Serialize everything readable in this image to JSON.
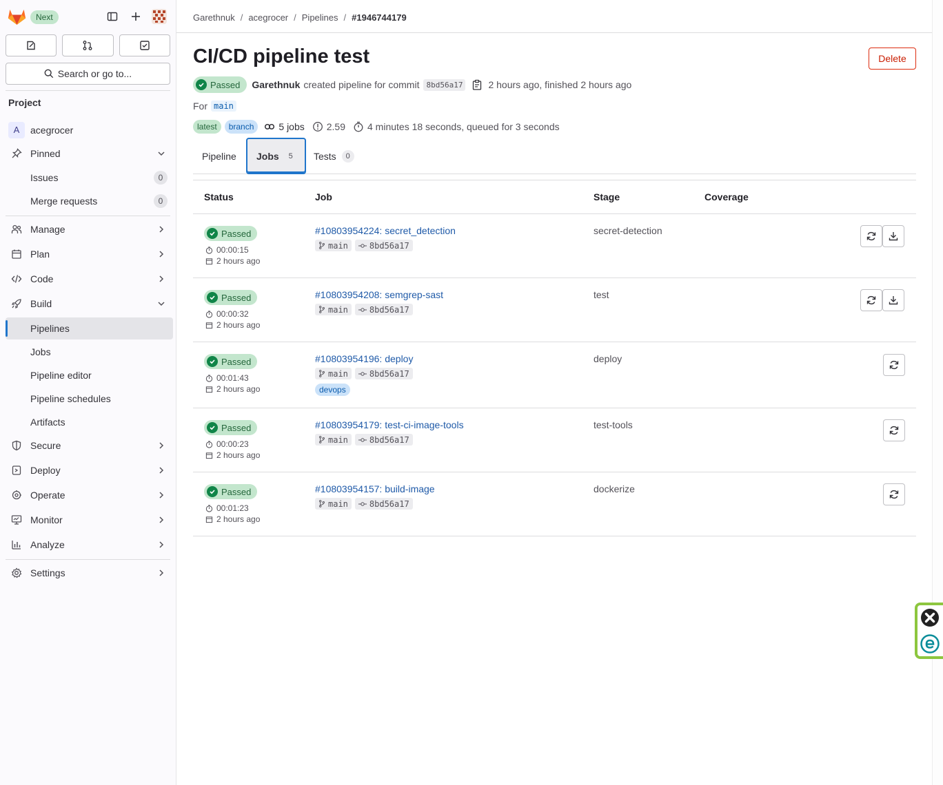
{
  "sidebar": {
    "next_badge": "Next",
    "search_label": "Search or go to...",
    "section_title": "Project",
    "project_avatar_letter": "A",
    "project_name": "acegrocer",
    "items": {
      "pinned": "Pinned",
      "issues": "Issues",
      "issues_count": "0",
      "merge_requests": "Merge requests",
      "merge_requests_count": "0",
      "manage": "Manage",
      "plan": "Plan",
      "code": "Code",
      "build": "Build",
      "pipelines": "Pipelines",
      "jobs": "Jobs",
      "pipeline_editor": "Pipeline editor",
      "pipeline_schedules": "Pipeline schedules",
      "artifacts": "Artifacts",
      "secure": "Secure",
      "deploy": "Deploy",
      "operate": "Operate",
      "monitor": "Monitor",
      "analyze": "Analyze",
      "settings": "Settings"
    }
  },
  "breadcrumb": {
    "items": [
      "Garethnuk",
      "acegrocer",
      "Pipelines"
    ],
    "current": "#1946744179"
  },
  "header": {
    "title": "CI/CD pipeline test",
    "delete_label": "Delete",
    "status": "Passed",
    "author": "Garethnuk",
    "created_text": "created pipeline for commit",
    "commit": "8bd56a17",
    "timing": "2 hours ago, finished 2 hours ago",
    "for_label": "For",
    "branch": "main",
    "tag_latest": "latest",
    "tag_branch": "branch",
    "jobs_count": "5 jobs",
    "compute": "2.59",
    "duration": "4 minutes 18 seconds, queued for 3 seconds"
  },
  "tabs": {
    "pipeline": "Pipeline",
    "jobs": "Jobs",
    "jobs_count": "5",
    "tests": "Tests",
    "tests_count": "0"
  },
  "table": {
    "headers": {
      "status": "Status",
      "job": "Job",
      "stage": "Stage",
      "coverage": "Coverage"
    },
    "rows": [
      {
        "status": "Passed",
        "duration": "00:00:15",
        "when": "2 hours ago",
        "job": "#10803954224: secret_detection",
        "branch": "main",
        "commit": "8bd56a17",
        "stage": "secret-detection"
      },
      {
        "status": "Passed",
        "duration": "00:00:32",
        "when": "2 hours ago",
        "job": "#10803954208: semgrep-sast",
        "branch": "main",
        "commit": "8bd56a17",
        "stage": "test"
      },
      {
        "status": "Passed",
        "duration": "00:01:43",
        "when": "2 hours ago",
        "job": "#10803954196: deploy",
        "branch": "main",
        "commit": "8bd56a17",
        "stage": "deploy",
        "tag": "devops"
      },
      {
        "status": "Passed",
        "duration": "00:00:23",
        "when": "2 hours ago",
        "job": "#10803954179: test-ci-image-tools",
        "branch": "main",
        "commit": "8bd56a17",
        "stage": "test-tools"
      },
      {
        "status": "Passed",
        "duration": "00:01:23",
        "when": "2 hours ago",
        "job": "#10803954157: build-image",
        "branch": "main",
        "commit": "8bd56a17",
        "stage": "dockerize"
      }
    ]
  },
  "colors": {
    "accent": "#1f75cb",
    "success": "#108548",
    "danger": "#dd2b0e",
    "link": "#1f5aa8"
  }
}
